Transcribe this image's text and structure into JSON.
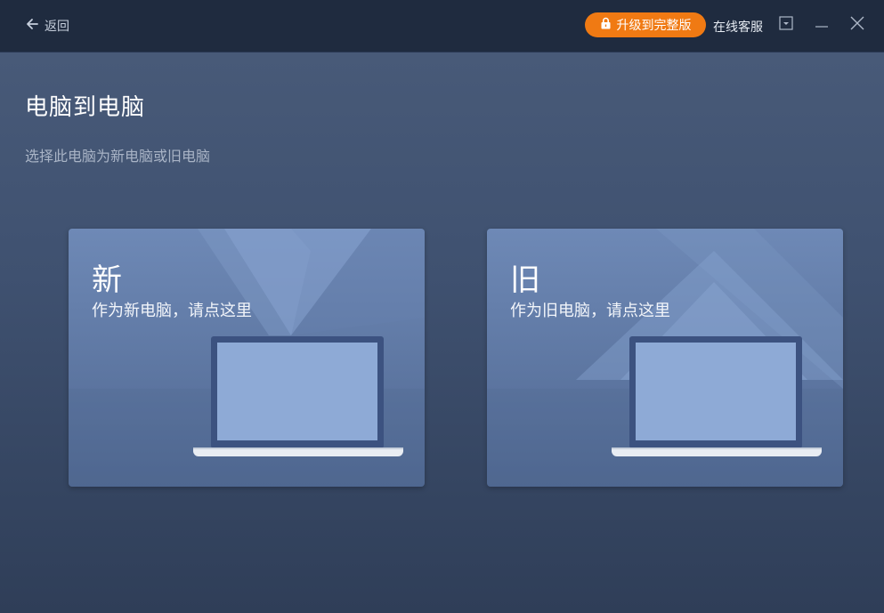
{
  "titlebar": {
    "back_label": "返回",
    "upgrade_label": "升级到完整版",
    "support_label": "在线客服"
  },
  "page": {
    "title": "电脑到电脑",
    "subtitle": "选择此电脑为新电脑或旧电脑"
  },
  "cards": [
    {
      "title": "新",
      "description": "作为新电脑，请点这里"
    },
    {
      "title": "旧",
      "description": "作为旧电脑，请点这里"
    }
  ],
  "colors": {
    "titlebar_bg": "#1f2b3f",
    "upgrade_bg": "#f07a13",
    "card_bg": "#6e89b6",
    "screen": "#8eaad6"
  },
  "icons": [
    "arrow-left-icon",
    "lock-icon",
    "dropdown-icon",
    "minimize-icon",
    "close-icon",
    "laptop-icon"
  ]
}
